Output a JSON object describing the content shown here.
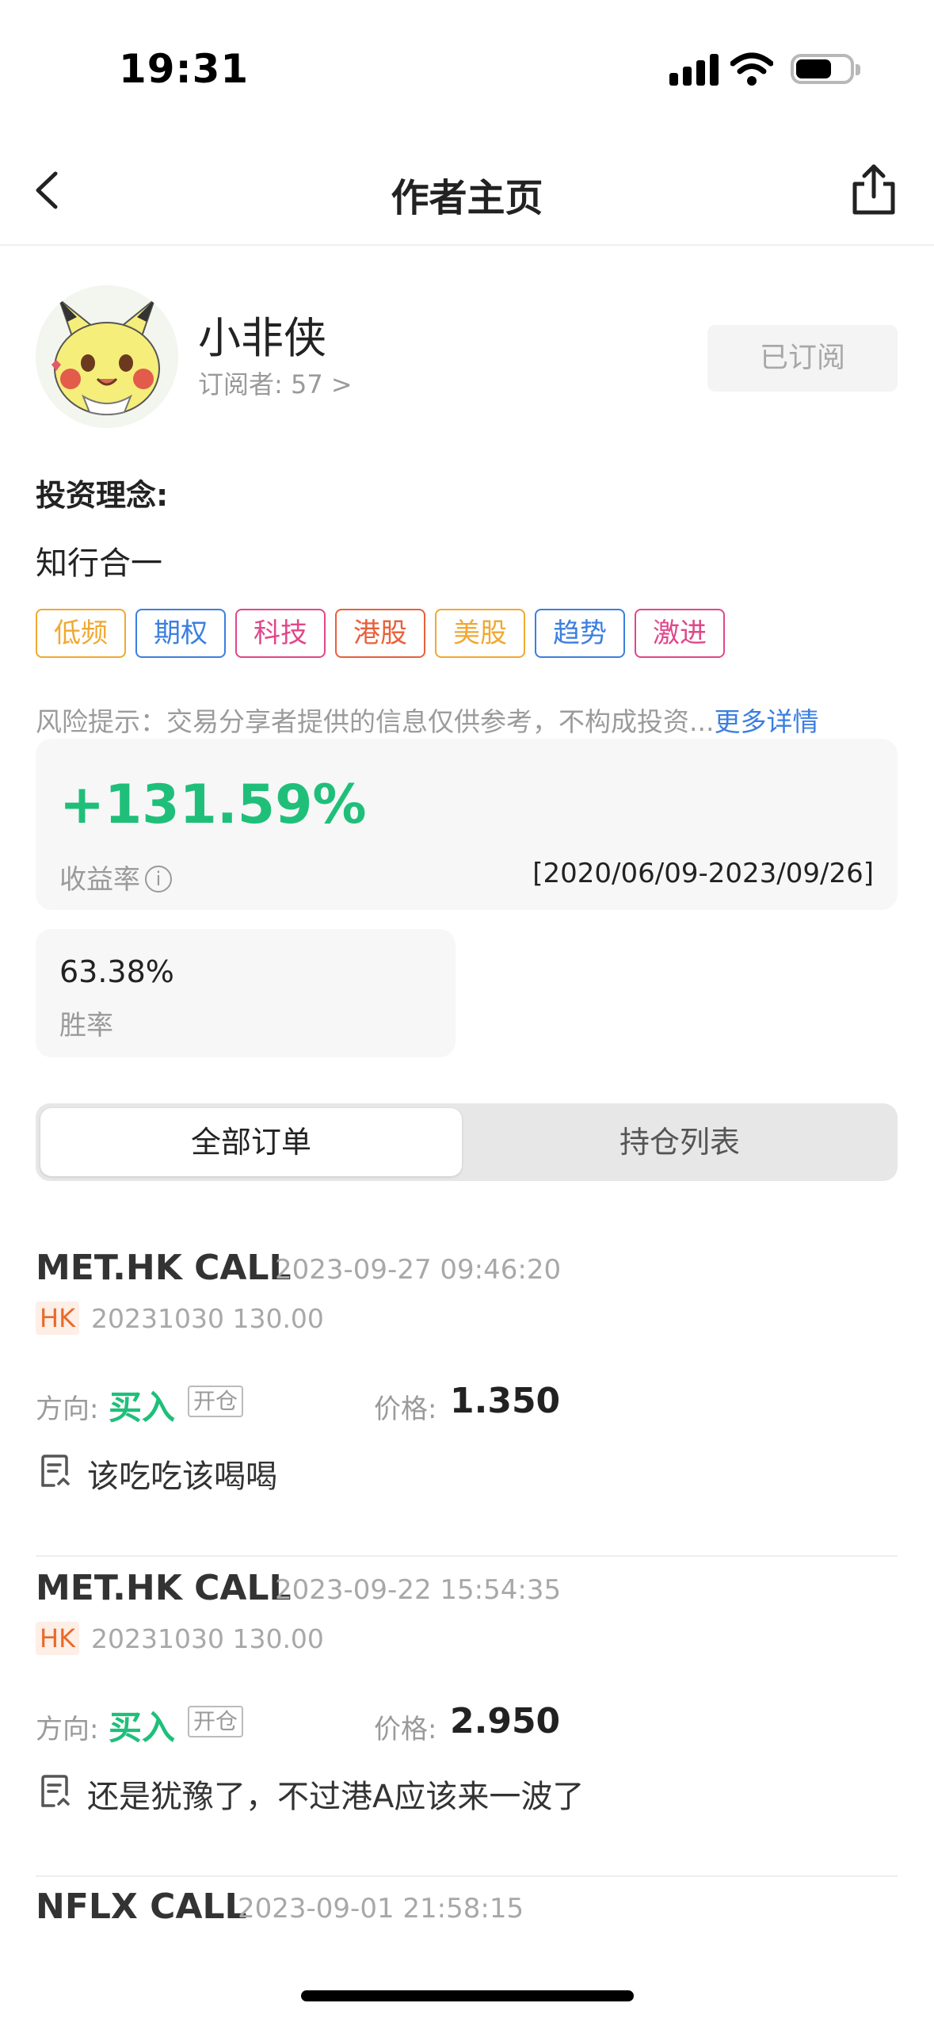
{
  "status_bar": {
    "time": "19:31"
  },
  "header": {
    "title": "作者主页"
  },
  "author": {
    "name": "小非侠",
    "subscribers": "订阅者: 57 >",
    "subscribe_button": "已订阅"
  },
  "philosophy": {
    "label": "投资理念:",
    "text": "知行合一"
  },
  "tags": [
    {
      "label": "低频",
      "color": "#f0a830"
    },
    {
      "label": "期权",
      "color": "#3b7fe0"
    },
    {
      "label": "科技",
      "color": "#e0478a"
    },
    {
      "label": "港股",
      "color": "#e8603a"
    },
    {
      "label": "美股",
      "color": "#f0a830"
    },
    {
      "label": "趋势",
      "color": "#3b7fe0"
    },
    {
      "label": "激进",
      "color": "#e0478a"
    }
  ],
  "risk": {
    "text": "风险提示：交易分享者提供的信息仅供参考，不构成投资...",
    "more": "更多详情"
  },
  "performance": {
    "return_value": "+131.59%",
    "return_label": "收益率",
    "date_range": "[2020/06/09-2023/09/26]",
    "win_rate": "63.38%",
    "win_rate_label": "胜率"
  },
  "tabs": [
    {
      "label": "全部订单",
      "active": true
    },
    {
      "label": "持仓列表",
      "active": false
    }
  ],
  "orders": [
    {
      "title": "MET.HK CALL",
      "time": "2023-09-27 09:46:20",
      "market": "HK",
      "contract": "20231030 130.00",
      "direction_label": "方向:",
      "direction": "买入",
      "badge": "开仓",
      "price_label": "价格:",
      "price": "1.350",
      "note": "该吃吃该喝喝"
    },
    {
      "title": "MET.HK CALL",
      "time": "2023-09-22 15:54:35",
      "market": "HK",
      "contract": "20231030 130.00",
      "direction_label": "方向:",
      "direction": "买入",
      "badge": "开仓",
      "price_label": "价格:",
      "price": "2.950",
      "note": "还是犹豫了，不过港A应该来一波了"
    },
    {
      "title": "NFLX CALL",
      "time": "2023-09-01 21:58:15"
    }
  ]
}
